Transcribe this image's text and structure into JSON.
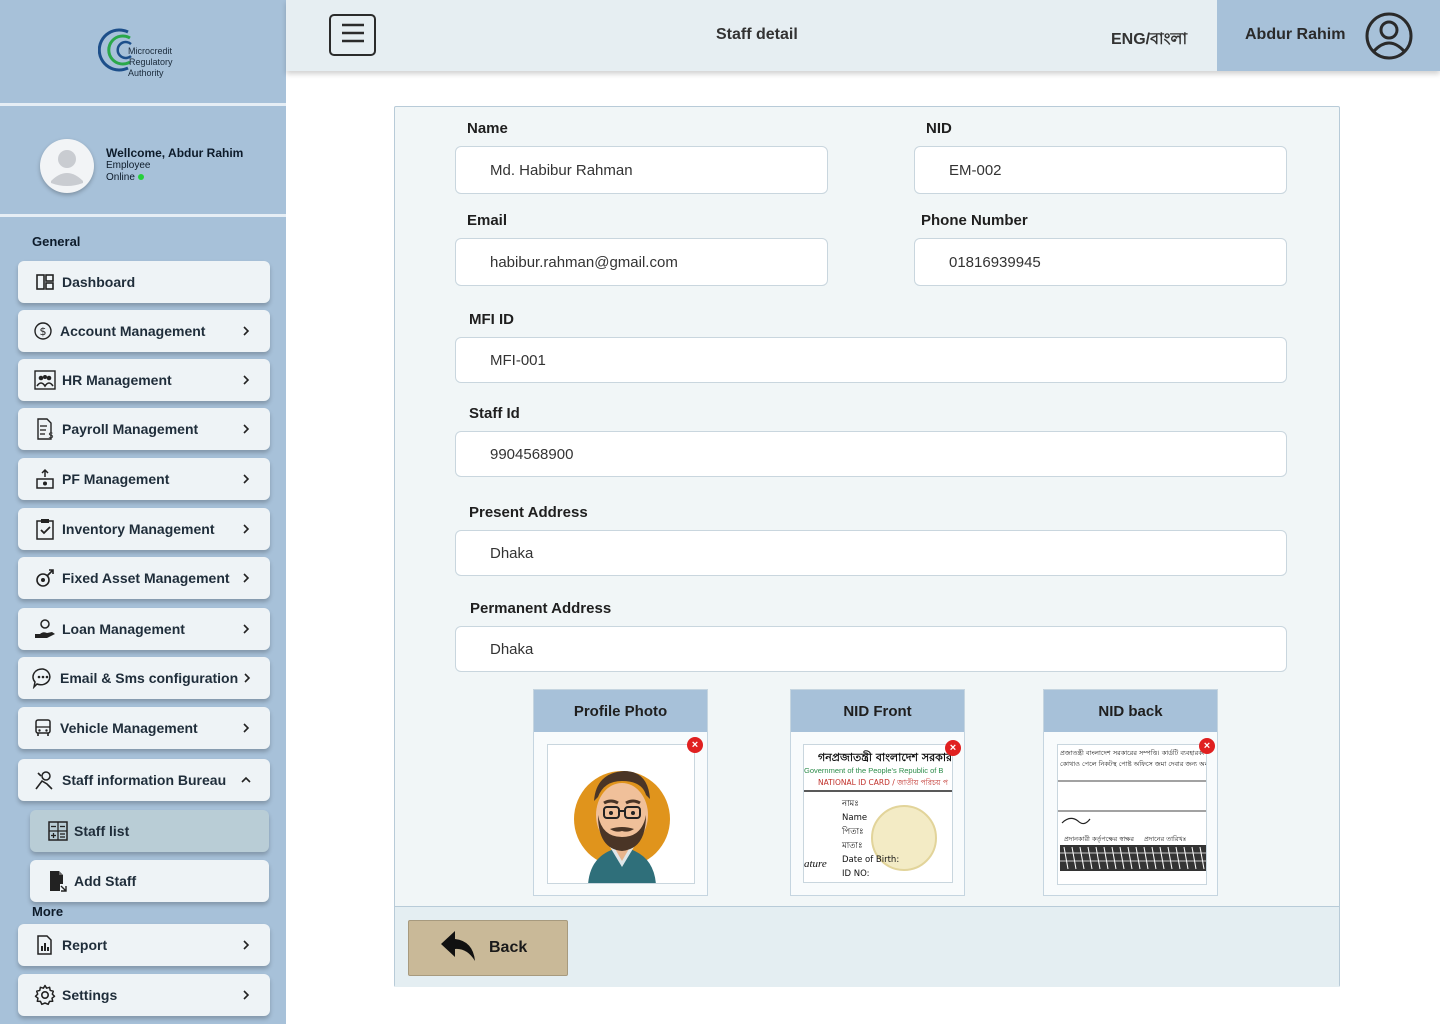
{
  "app": {
    "logo_text": [
      "Microcredit",
      "Regulatory",
      "Authority"
    ]
  },
  "user_panel": {
    "welcome": "Wellcome, Abdur Rahim",
    "role": "Employee",
    "status": "Online"
  },
  "sidebar": {
    "general_title": "General",
    "more_title": "More",
    "items": [
      {
        "label": "Dashboard",
        "icon": "dashboard-icon"
      },
      {
        "label": "Account Management",
        "icon": "dollar-circle-icon"
      },
      {
        "label": "HR Management",
        "icon": "people-icon"
      },
      {
        "label": "Payroll Management",
        "icon": "invoice-icon"
      },
      {
        "label": "PF Management",
        "icon": "fund-icon"
      },
      {
        "label": "Inventory Management",
        "icon": "clipboard-check-icon"
      },
      {
        "label": "Fixed Asset Management",
        "icon": "asset-icon"
      },
      {
        "label": "Loan Management",
        "icon": "hand-coin-icon"
      },
      {
        "label": "Email & Sms configuration",
        "icon": "chat-icon"
      },
      {
        "label": "Vehicle Management",
        "icon": "bus-icon"
      },
      {
        "label": "Staff information Bureau",
        "icon": "staff-search-icon"
      }
    ],
    "sub_items": [
      {
        "label": "Staff list",
        "icon": "calculator-list-icon"
      },
      {
        "label": "Add Staff",
        "icon": "add-file-icon"
      }
    ],
    "more_items": [
      {
        "label": "Report",
        "icon": "report-icon"
      },
      {
        "label": "Settings",
        "icon": "gear-icon"
      }
    ]
  },
  "header": {
    "title": "Staff detail",
    "language": "ENG/বাংলা",
    "user_name": "Abdur Rahim"
  },
  "form": {
    "name_label": "Name",
    "name_value": "Md. Habibur Rahman",
    "nid_label": "NID",
    "nid_value": "EM-002",
    "email_label": "Email",
    "email_value": "habibur.rahman@gmail.com",
    "phone_label": "Phone Number",
    "phone_value": "01816939945",
    "mfi_label": "MFI ID",
    "mfi_value": "MFI-001",
    "staff_id_label": "Staff Id",
    "staff_id_value": "9904568900",
    "present_label": "Present Address",
    "present_value": "Dhaka",
    "permanent_label": "Permanent Address",
    "permanent_value": "Dhaka"
  },
  "uploads": {
    "profile_label": "Profile Photo",
    "nid_front_label": "NID Front",
    "nid_back_label": "NID back",
    "remove_symbol": "×",
    "nid_front_text": {
      "gov_bn": "গনপ্রজাতন্ত্রী বাংলাদেশ সরকার",
      "gov_en": "Government of the People's Republic of B",
      "card": "NATIONAL ID CARD / জাতীয় পরিচয় প",
      "fields": [
        "নামঃ",
        "Name",
        "পিতাঃ",
        "মাতাঃ",
        "Date of Birth:",
        "ID NO:"
      ],
      "signature": "ature"
    },
    "nid_back_text": {
      "line1": "প্রজাতন্ত্রী বাংলাদেশ সরকারের সম্পত্তি। কার্ডটি ব্যবহারকা",
      "line2": "কোথাও পেলে নিকটস্থ পোষ্ট অফিসে জমা দেবার জন্য অনুরোধ ক",
      "line3": "প্রদানকারী কর্তৃপক্ষের স্বাক্ষর",
      "line4": "প্রদানের তারিখঃ"
    }
  },
  "actions": {
    "back_label": "Back"
  }
}
